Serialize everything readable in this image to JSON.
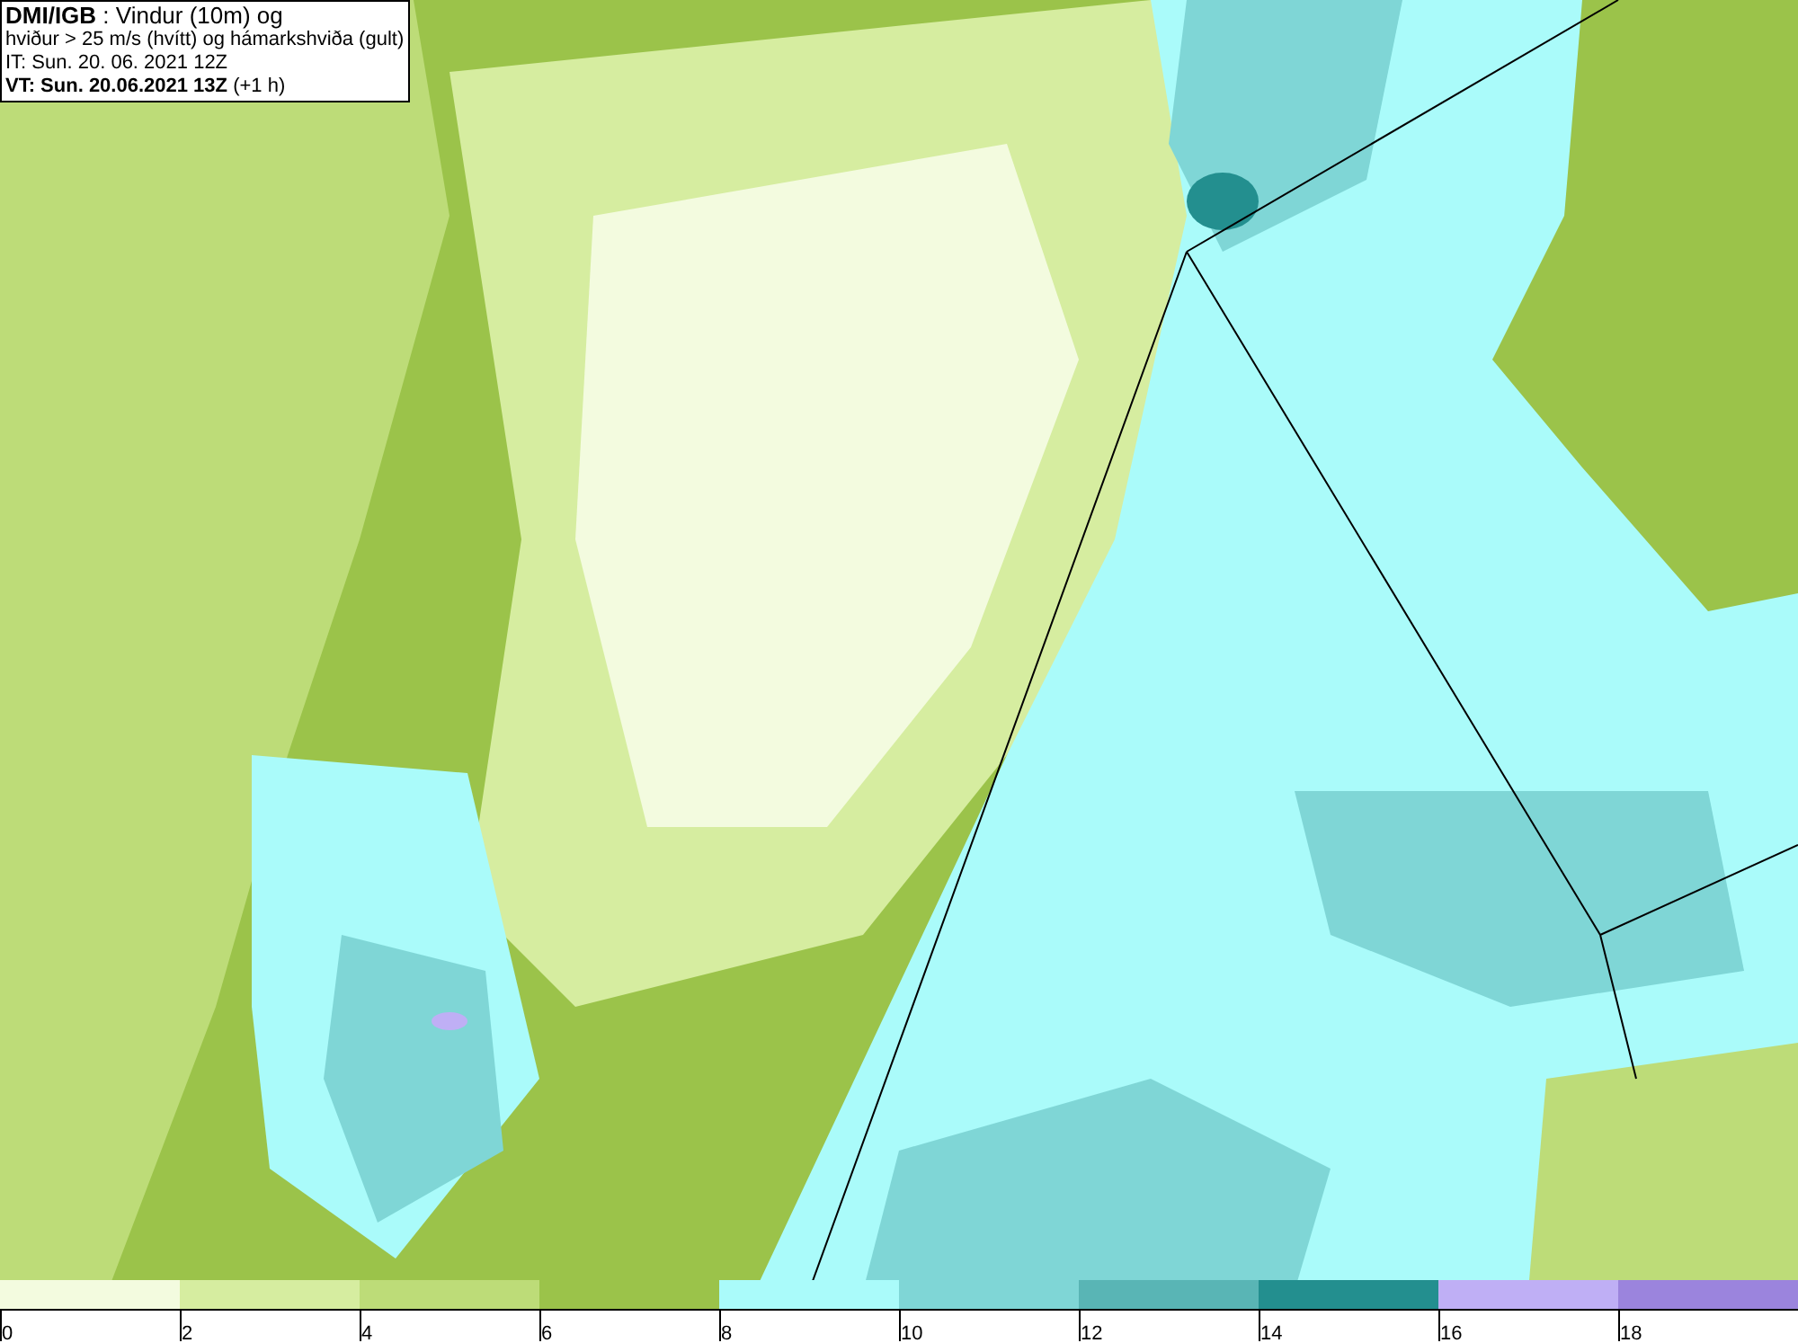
{
  "title_box": {
    "lines": [
      "**DMI/IGB** : Vindur (10m) og",
      "hviður > 25 m/s (hvítt) og hámarkshviða (gult)",
      "IT: Sun. 20. 06. 2021 12Z",
      "**VT: Sun. 20.06.2021 13Z** (+1 h)"
    ]
  },
  "legend": {
    "bins": [
      {
        "label": "0",
        "color": "#f3fbdf"
      },
      {
        "label": "2",
        "color": "#d6eda0"
      },
      {
        "label": "4",
        "color": "#bddc78"
      },
      {
        "label": "6",
        "color": "#9bc34a"
      },
      {
        "label": "8",
        "color": "#aafbfa"
      },
      {
        "label": "10",
        "color": "#7fd6d6"
      },
      {
        "label": "12",
        "color": "#59b5b5"
      },
      {
        "label": "14",
        "color": "#238f8f"
      },
      {
        "label": "16",
        "color": "#bfaff5"
      },
      {
        "label": "18",
        "color": "#9b84dd"
      }
    ]
  }
}
